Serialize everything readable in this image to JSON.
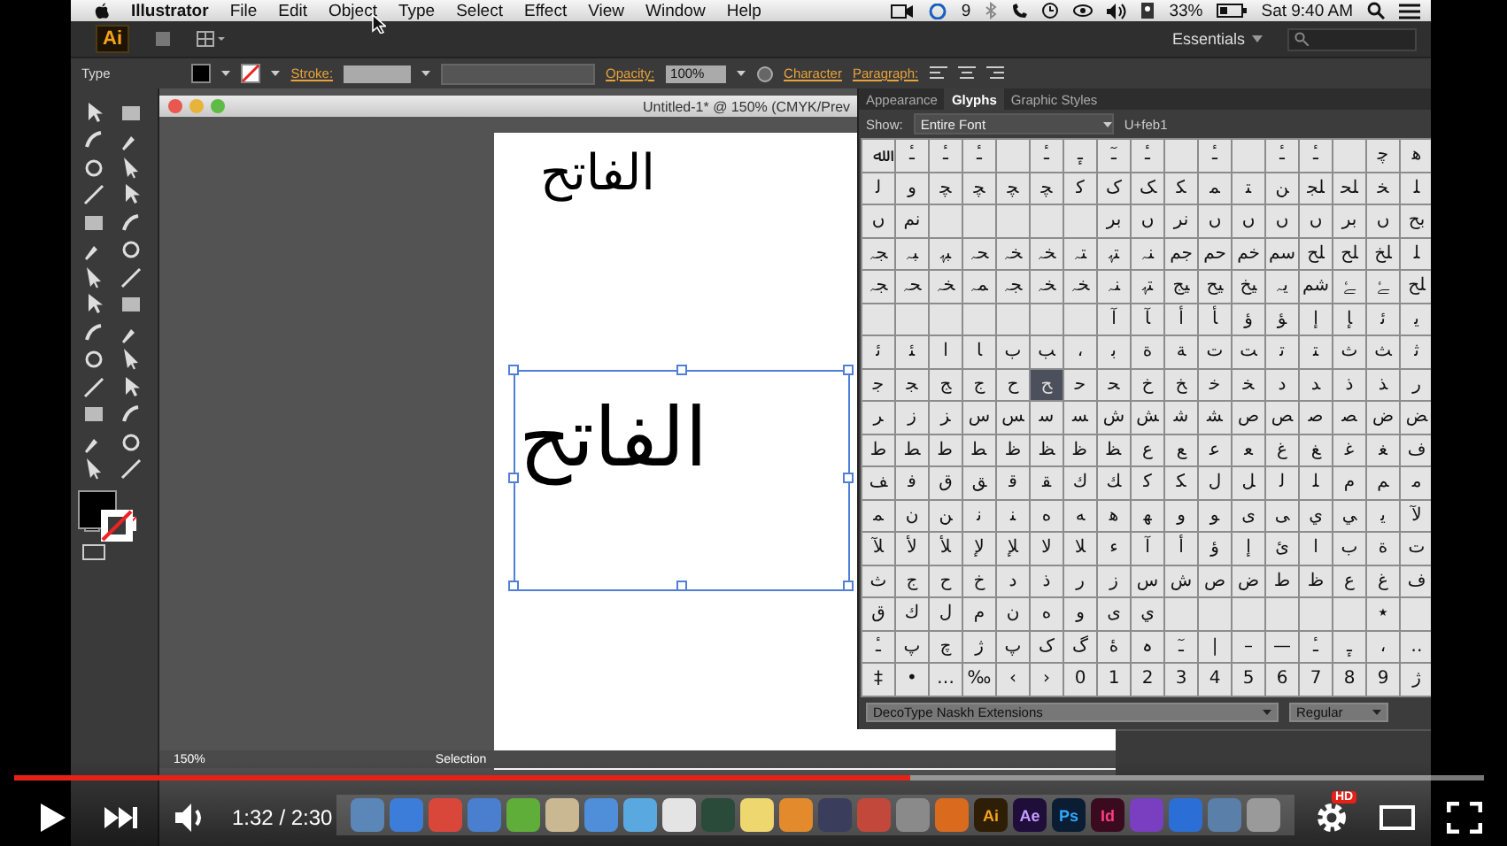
{
  "menu_bar": {
    "app": "Illustrator",
    "items": [
      "File",
      "Edit",
      "Object",
      "Type",
      "Select",
      "Effect",
      "View",
      "Window",
      "Help"
    ],
    "badge": "9",
    "battery": "33%",
    "clock": "Sat 9:40 AM"
  },
  "app_bar": {
    "logo": "Ai",
    "workspace": "Essentials"
  },
  "control_bar": {
    "mode": "Type",
    "stroke_label": "Stroke:",
    "opacity_label": "Opacity:",
    "opacity": "100%",
    "links": [
      "Character",
      "Paragraph:"
    ]
  },
  "document": {
    "title": "Untitled-1* @ 150% (CMYK/Prev",
    "texts": [
      "الفاتح",
      "الفاتح"
    ]
  },
  "status_bar": {
    "zoom": "150%",
    "tool": "Selection"
  },
  "glyphs_panel": {
    "tabs": [
      {
        "label": "Appearance",
        "selected": false
      },
      {
        "label": "Glyphs",
        "selected": true
      },
      {
        "label": "Graphic Styles",
        "selected": false
      }
    ],
    "show_label": "Show:",
    "show": "Entire Font",
    "code": "U+feb1",
    "font": "DecoType Naskh Extensions",
    "style": "Regular",
    "rows": [
      [
        {
          "glyph": "ﷲ",
          "selected": false
        },
        {
          "glyph": "ـٔ",
          "selected": false
        },
        {
          "glyph": "ـٔ",
          "selected": false
        },
        {
          "glyph": "ـٔ",
          "selected": false
        },
        {
          "selected": false
        },
        {
          "glyph": "ـٔ",
          "selected": false
        },
        {
          "glyph": "ـٕ",
          "selected": false
        },
        {
          "glyph": "ـٓ",
          "selected": false
        },
        {
          "glyph": "ـٔ",
          "selected": false
        },
        {
          "selected": false
        },
        {
          "glyph": "ـٔ",
          "selected": false
        },
        {
          "selected": false
        },
        {
          "glyph": "ـٔ",
          "selected": false
        },
        {
          "glyph": "ـٔ",
          "selected": false
        },
        {
          "selected": false
        },
        {
          "glyph": "ﭼ",
          "selected": false
        },
        {
          "glyph": "ﮬ",
          "selected": false
        }
      ],
      [
        {
          "glyph": "ﻟ",
          "selected": false
        },
        {
          "glyph": "ﻭ",
          "selected": false
        },
        {
          "glyph": "ﭽ",
          "selected": false
        },
        {
          "glyph": "ﭽ",
          "selected": false
        },
        {
          "glyph": "ﭽ",
          "selected": false
        },
        {
          "glyph": "ﭽ",
          "selected": false
        },
        {
          "glyph": "ﮐ",
          "selected": false
        },
        {
          "glyph": "ﮎ",
          "selected": false
        },
        {
          "glyph": "ﮏ",
          "selected": false
        },
        {
          "glyph": "ﮑ",
          "selected": false
        },
        {
          "glyph": "ﻤ",
          "selected": false
        },
        {
          "glyph": "ﺘ",
          "selected": false
        },
        {
          "glyph": "ﻦ",
          "selected": false
        },
        {
          "glyph": "ﻠﺠ",
          "selected": false
        },
        {
          "glyph": "ﻠﺤ",
          "selected": false
        },
        {
          "glyph": "ﺨ",
          "selected": false
        },
        {
          "glyph": "ﻠ",
          "selected": false
        }
      ],
      [
        {
          "glyph": "ں",
          "selected": false
        },
        {
          "glyph": "ﻧﻢ",
          "selected": false
        },
        {
          "selected": false
        },
        {
          "selected": false
        },
        {
          "selected": false
        },
        {
          "selected": false
        },
        {
          "selected": false
        },
        {
          "glyph": "ﺑﺮ",
          "selected": false
        },
        {
          "glyph": "ں",
          "selected": false
        },
        {
          "glyph": "ﻧﺮ",
          "selected": false
        },
        {
          "glyph": "ں",
          "selected": false
        },
        {
          "glyph": "ں",
          "selected": false
        },
        {
          "glyph": "ں",
          "selected": false
        },
        {
          "glyph": "ں",
          "selected": false
        },
        {
          "glyph": "ﺑﺮ",
          "selected": false
        },
        {
          "glyph": "ں",
          "selected": false
        },
        {
          "glyph": "ﺑﺢ",
          "selected": false
        }
      ],
      [
        {
          "glyph": "ﺠﮧ",
          "selected": false
        },
        {
          "glyph": "ﺒﮧ",
          "selected": false
        },
        {
          "glyph": "ﺒﮩ",
          "selected": false
        },
        {
          "glyph": "ﺤﮧ",
          "selected": false
        },
        {
          "glyph": "ﺨﮧ",
          "selected": false
        },
        {
          "glyph": "ﺨﮧ",
          "selected": false
        },
        {
          "glyph": "ﺘﮧ",
          "selected": false
        },
        {
          "glyph": "ﺘﮩ",
          "selected": false
        },
        {
          "glyph": "ﻨﮧ",
          "selected": false
        },
        {
          "glyph": "ﺟﻢ",
          "selected": false
        },
        {
          "glyph": "ﺣﻢ",
          "selected": false
        },
        {
          "glyph": "ﺧﻢ",
          "selected": false
        },
        {
          "glyph": "ﺳﻢ",
          "selected": false
        },
        {
          "glyph": "ﻠﺢ",
          "selected": false
        },
        {
          "glyph": "ﻠﺢ",
          "selected": false
        },
        {
          "glyph": "ﻠﺦ",
          "selected": false
        },
        {
          "glyph": "ﻠ",
          "selected": false
        }
      ],
      [
        {
          "glyph": "ﺠﮧ",
          "selected": false
        },
        {
          "glyph": "ﺤﮧ",
          "selected": false
        },
        {
          "glyph": "ﺨﮧ",
          "selected": false
        },
        {
          "glyph": "ﻤﮧ",
          "selected": false
        },
        {
          "glyph": "ﺠﮧ",
          "selected": false
        },
        {
          "glyph": "ﺨﮧ",
          "selected": false
        },
        {
          "glyph": "ﺨﮧ",
          "selected": false
        },
        {
          "glyph": "ﻨﮧ",
          "selected": false
        },
        {
          "glyph": "ﺘﮩ",
          "selected": false
        },
        {
          "glyph": "ﯿﺞ",
          "selected": false
        },
        {
          "glyph": "ﯿﺢ",
          "selected": false
        },
        {
          "glyph": "ﯿﺦ",
          "selected": false
        },
        {
          "glyph": "ﯾﮧ",
          "selected": false
        },
        {
          "glyph": "ﺷﻢ",
          "selected": false
        },
        {
          "glyph": "ﮱ",
          "selected": false
        },
        {
          "glyph": "ﮱ",
          "selected": false
        },
        {
          "glyph": "ﻠﺢ",
          "selected": false
        }
      ],
      [
        {
          "selected": false
        },
        {
          "selected": false
        },
        {
          "selected": false
        },
        {
          "selected": false
        },
        {
          "selected": false
        },
        {
          "selected": false
        },
        {
          "selected": false
        },
        {
          "glyph": "ﺁ",
          "selected": false
        },
        {
          "glyph": "ﺂ",
          "selected": false
        },
        {
          "glyph": "ﺃ",
          "selected": false
        },
        {
          "glyph": "ﺄ",
          "selected": false
        },
        {
          "glyph": "ﺅ",
          "selected": false
        },
        {
          "glyph": "ﺆ",
          "selected": false
        },
        {
          "glyph": "ﺇ",
          "selected": false
        },
        {
          "glyph": "ﺈ",
          "selected": false
        },
        {
          "glyph": "ﺋ",
          "selected": false
        },
        {
          "glyph": "ﯾ",
          "selected": false
        }
      ],
      [
        {
          "glyph": "ﺋ",
          "selected": false
        },
        {
          "glyph": "ﺌ",
          "selected": false
        },
        {
          "glyph": "ﺍ",
          "selected": false
        },
        {
          "glyph": "ﺎ",
          "selected": false
        },
        {
          "glyph": "ﺏ",
          "selected": false
        },
        {
          "glyph": "ﺐ",
          "selected": false
        },
        {
          "glyph": "،",
          "selected": false
        },
        {
          "glyph": "ﺑ",
          "selected": false
        },
        {
          "glyph": "ﺓ",
          "selected": false
        },
        {
          "glyph": "ﺔ",
          "selected": false
        },
        {
          "glyph": "ﺕ",
          "selected": false
        },
        {
          "glyph": "ﺖ",
          "selected": false
        },
        {
          "glyph": "ﺗ",
          "selected": false
        },
        {
          "glyph": "ﺘ",
          "selected": false
        },
        {
          "glyph": "ﺙ",
          "selected": false
        },
        {
          "glyph": "ﺚ",
          "selected": false
        },
        {
          "glyph": "ﺛ",
          "selected": false
        }
      ],
      [
        {
          "glyph": "ﺟ",
          "selected": false
        },
        {
          "glyph": "ﺠ",
          "selected": false
        },
        {
          "glyph": "ﺞ",
          "selected": false
        },
        {
          "glyph": "ﺝ",
          "selected": false
        },
        {
          "glyph": "ﺡ",
          "selected": false
        },
        {
          "glyph": "ﺢ",
          "selected": true
        },
        {
          "glyph": "ﺣ",
          "selected": false
        },
        {
          "glyph": "ﺤ",
          "selected": false
        },
        {
          "glyph": "ﺥ",
          "selected": false
        },
        {
          "glyph": "ﺦ",
          "selected": false
        },
        {
          "glyph": "ﺧ",
          "selected": false
        },
        {
          "glyph": "ﺨ",
          "selected": false
        },
        {
          "glyph": "ﺩ",
          "selected": false
        },
        {
          "glyph": "ﺪ",
          "selected": false
        },
        {
          "glyph": "ﺫ",
          "selected": false
        },
        {
          "glyph": "ﺬ",
          "selected": false
        },
        {
          "glyph": "ﺭ",
          "selected": false
        }
      ],
      [
        {
          "glyph": "ﺮ",
          "selected": false
        },
        {
          "glyph": "ﺯ",
          "selected": false
        },
        {
          "glyph": "ﺰ",
          "selected": false
        },
        {
          "glyph": "ﺱ",
          "selected": false
        },
        {
          "glyph": "ﺲ",
          "selected": false
        },
        {
          "glyph": "ﺳ",
          "selected": false
        },
        {
          "glyph": "ﺴ",
          "selected": false
        },
        {
          "glyph": "ﺵ",
          "selected": false
        },
        {
          "glyph": "ﺶ",
          "selected": false
        },
        {
          "glyph": "ﺷ",
          "selected": false
        },
        {
          "glyph": "ﺸ",
          "selected": false
        },
        {
          "glyph": "ﺹ",
          "selected": false
        },
        {
          "glyph": "ﺺ",
          "selected": false
        },
        {
          "glyph": "ﺻ",
          "selected": false
        },
        {
          "glyph": "ﺼ",
          "selected": false
        },
        {
          "glyph": "ﺽ",
          "selected": false
        },
        {
          "glyph": "ﺾ",
          "selected": false
        }
      ],
      [
        {
          "glyph": "ﻁ",
          "selected": false
        },
        {
          "glyph": "ﻂ",
          "selected": false
        },
        {
          "glyph": "ﻃ",
          "selected": false
        },
        {
          "glyph": "ﻄ",
          "selected": false
        },
        {
          "glyph": "ﻅ",
          "selected": false
        },
        {
          "glyph": "ﻆ",
          "selected": false
        },
        {
          "glyph": "ﻇ",
          "selected": false
        },
        {
          "glyph": "ﻈ",
          "selected": false
        },
        {
          "glyph": "ﻉ",
          "selected": false
        },
        {
          "glyph": "ﻊ",
          "selected": false
        },
        {
          "glyph": "ﻋ",
          "selected": false
        },
        {
          "glyph": "ﻌ",
          "selected": false
        },
        {
          "glyph": "ﻍ",
          "selected": false
        },
        {
          "glyph": "ﻎ",
          "selected": false
        },
        {
          "glyph": "ﻏ",
          "selected": false
        },
        {
          "glyph": "ﻐ",
          "selected": false
        },
        {
          "glyph": "ﻑ",
          "selected": false
        }
      ],
      [
        {
          "glyph": "ﻒ",
          "selected": false
        },
        {
          "glyph": "ﻓ",
          "selected": false
        },
        {
          "glyph": "ﻕ",
          "selected": false
        },
        {
          "glyph": "ﻖ",
          "selected": false
        },
        {
          "glyph": "ﻗ",
          "selected": false
        },
        {
          "glyph": "ﻘ",
          "selected": false
        },
        {
          "glyph": "ﻙ",
          "selected": false
        },
        {
          "glyph": "ﻚ",
          "selected": false
        },
        {
          "glyph": "ﻛ",
          "selected": false
        },
        {
          "glyph": "ﻜ",
          "selected": false
        },
        {
          "glyph": "ﻝ",
          "selected": false
        },
        {
          "glyph": "ﻞ",
          "selected": false
        },
        {
          "glyph": "ﻟ",
          "selected": false
        },
        {
          "glyph": "ﻠ",
          "selected": false
        },
        {
          "glyph": "ﻡ",
          "selected": false
        },
        {
          "glyph": "ﻢ",
          "selected": false
        },
        {
          "glyph": "ﻣ",
          "selected": false
        }
      ],
      [
        {
          "glyph": "ﻤ",
          "selected": false
        },
        {
          "glyph": "ﻥ",
          "selected": false
        },
        {
          "glyph": "ﻦ",
          "selected": false
        },
        {
          "glyph": "ﻧ",
          "selected": false
        },
        {
          "glyph": "ﻨ",
          "selected": false
        },
        {
          "glyph": "ﻩ",
          "selected": false
        },
        {
          "glyph": "ﻪ",
          "selected": false
        },
        {
          "glyph": "ﻫ",
          "selected": false
        },
        {
          "glyph": "ﻬ",
          "selected": false
        },
        {
          "glyph": "ﻭ",
          "selected": false
        },
        {
          "glyph": "ﻮ",
          "selected": false
        },
        {
          "glyph": "ﻯ",
          "selected": false
        },
        {
          "glyph": "ﻰ",
          "selected": false
        },
        {
          "glyph": "ﻱ",
          "selected": false
        },
        {
          "glyph": "ﻲ",
          "selected": false
        },
        {
          "glyph": "ﻳ",
          "selected": false
        },
        {
          "glyph": "ﻵ",
          "selected": false
        }
      ],
      [
        {
          "glyph": "ﻶ",
          "selected": false
        },
        {
          "glyph": "ﻷ",
          "selected": false
        },
        {
          "glyph": "ﻸ",
          "selected": false
        },
        {
          "glyph": "ﻹ",
          "selected": false
        },
        {
          "glyph": "ﻺ",
          "selected": false
        },
        {
          "glyph": "ﻻ",
          "selected": false
        },
        {
          "glyph": "ﻼ",
          "selected": false
        },
        {
          "glyph": "ء",
          "selected": false
        },
        {
          "glyph": "آ",
          "selected": false
        },
        {
          "glyph": "أ",
          "selected": false
        },
        {
          "glyph": "ؤ",
          "selected": false
        },
        {
          "glyph": "إ",
          "selected": false
        },
        {
          "glyph": "ئ",
          "selected": false
        },
        {
          "glyph": "ا",
          "selected": false
        },
        {
          "glyph": "ب",
          "selected": false
        },
        {
          "glyph": "ة",
          "selected": false
        },
        {
          "glyph": "ت",
          "selected": false
        }
      ],
      [
        {
          "glyph": "ث",
          "selected": false
        },
        {
          "glyph": "ج",
          "selected": false
        },
        {
          "glyph": "ح",
          "selected": false
        },
        {
          "glyph": "خ",
          "selected": false
        },
        {
          "glyph": "د",
          "selected": false
        },
        {
          "glyph": "ذ",
          "selected": false
        },
        {
          "glyph": "ر",
          "selected": false
        },
        {
          "glyph": "ز",
          "selected": false
        },
        {
          "glyph": "س",
          "selected": false
        },
        {
          "glyph": "ش",
          "selected": false
        },
        {
          "glyph": "ص",
          "selected": false
        },
        {
          "glyph": "ض",
          "selected": false
        },
        {
          "glyph": "ط",
          "selected": false
        },
        {
          "glyph": "ظ",
          "selected": false
        },
        {
          "glyph": "ع",
          "selected": false
        },
        {
          "glyph": "غ",
          "selected": false
        },
        {
          "glyph": "ف",
          "selected": false
        }
      ],
      [
        {
          "glyph": "ق",
          "selected": false
        },
        {
          "glyph": "ك",
          "selected": false
        },
        {
          "glyph": "ل",
          "selected": false
        },
        {
          "glyph": "م",
          "selected": false
        },
        {
          "glyph": "ن",
          "selected": false
        },
        {
          "glyph": "ه",
          "selected": false
        },
        {
          "glyph": "و",
          "selected": false
        },
        {
          "glyph": "ى",
          "selected": false
        },
        {
          "glyph": "ي",
          "selected": false
        },
        {
          "selected": false
        },
        {
          "selected": false
        },
        {
          "selected": false
        },
        {
          "selected": false
        },
        {
          "selected": false
        },
        {
          "selected": false
        },
        {
          "glyph": "٭",
          "selected": false
        },
        {
          "selected": false
        }
      ],
      [
        {
          "glyph": "ـٔ",
          "selected": false
        },
        {
          "glyph": "پ",
          "selected": false
        },
        {
          "glyph": "چ",
          "selected": false
        },
        {
          "glyph": "ژ",
          "selected": false
        },
        {
          "glyph": "پ",
          "selected": false
        },
        {
          "glyph": "ک",
          "selected": false
        },
        {
          "glyph": "گ",
          "selected": false
        },
        {
          "glyph": "ۀ",
          "selected": false
        },
        {
          "glyph": "ہ",
          "selected": false
        },
        {
          "glyph": "ـٓ",
          "selected": false
        },
        {
          "glyph": "|",
          "selected": false
        },
        {
          "glyph": "–",
          "selected": false
        },
        {
          "glyph": "—",
          "selected": false
        },
        {
          "glyph": "ـٔ",
          "selected": false
        },
        {
          "glyph": "ـٕ",
          "selected": false
        },
        {
          "glyph": "،",
          "selected": false
        },
        {
          "glyph": "‥",
          "selected": false
        }
      ],
      [
        {
          "glyph": "‡",
          "selected": false
        },
        {
          "glyph": "•",
          "selected": false
        },
        {
          "glyph": "…",
          "selected": false
        },
        {
          "glyph": "‰",
          "selected": false
        },
        {
          "glyph": "‹",
          "selected": false
        },
        {
          "glyph": "›",
          "selected": false
        },
        {
          "glyph": "0",
          "selected": false
        },
        {
          "glyph": "1",
          "selected": false
        },
        {
          "glyph": "2",
          "selected": false
        },
        {
          "glyph": "3",
          "selected": false
        },
        {
          "glyph": "4",
          "selected": false
        },
        {
          "glyph": "5",
          "selected": false
        },
        {
          "glyph": "6",
          "selected": false
        },
        {
          "glyph": "7",
          "selected": false
        },
        {
          "glyph": "8",
          "selected": false
        },
        {
          "glyph": "9",
          "selected": false
        },
        {
          "glyph": "ژ",
          "selected": false
        }
      ]
    ]
  },
  "dock": [
    {
      "color": "#5b86b8"
    },
    {
      "color": "#3b7dd8"
    },
    {
      "color": "#d9473b"
    },
    {
      "color": "#4a7fd0"
    },
    {
      "color": "#5fae3a"
    },
    {
      "color": "#c9b892"
    },
    {
      "color": "#4f8ed8"
    },
    {
      "color": "#5aa8e0"
    },
    {
      "color": "#e4e4e4"
    },
    {
      "color": "#2a4a3a"
    },
    {
      "color": "#efd76f"
    },
    {
      "color": "#e28a2c"
    },
    {
      "color": "#3a3d5c"
    },
    {
      "color": "#c2483b"
    },
    {
      "color": "#8a8a8a"
    },
    {
      "color": "#d96a1e"
    },
    {
      "color": "#2d1e05",
      "label": "Ai"
    },
    {
      "color": "#1f0d3a",
      "label": "Ae"
    },
    {
      "color": "#0a1d33",
      "label": "Ps"
    },
    {
      "color": "#3a0b1e",
      "label": "Id"
    },
    {
      "color": "#7a3ec0"
    },
    {
      "color": "#2b6fd6"
    },
    {
      "color": "#5a7fa8"
    },
    {
      "color": "#9a9a9a"
    }
  ],
  "player": {
    "level": 0.61,
    "time": "1:32 / 2:30",
    "hd": "HD"
  }
}
